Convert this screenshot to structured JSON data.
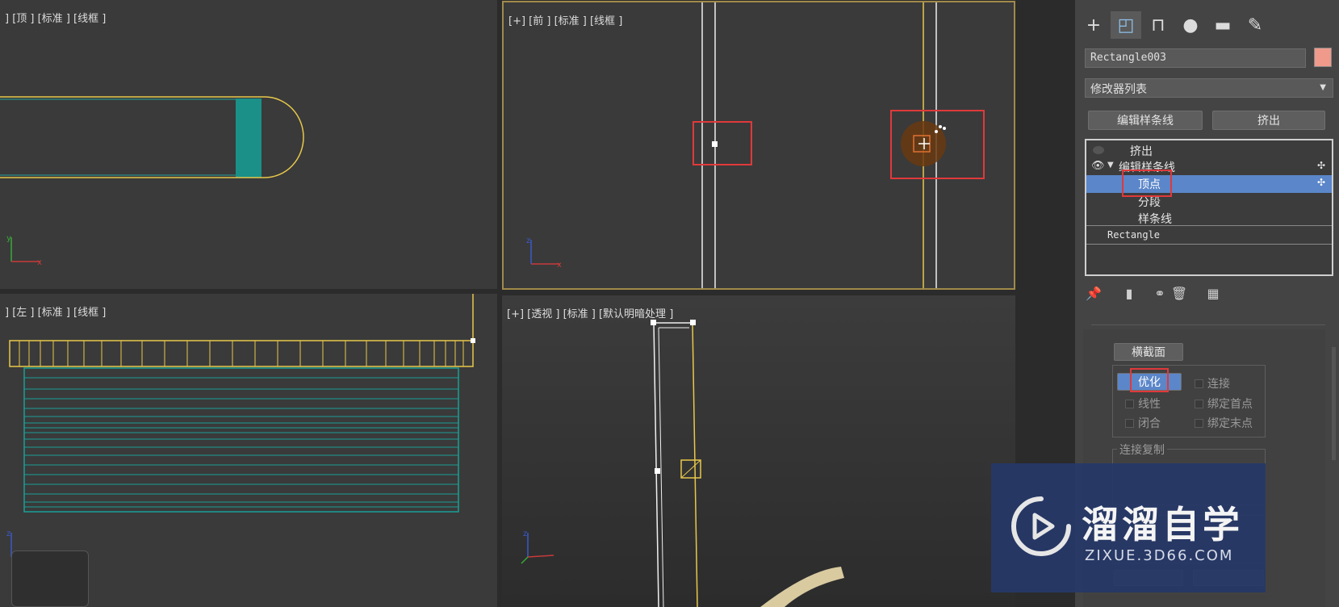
{
  "viewports": {
    "top_label": "] [顶 ] [标准 ] [线框 ]",
    "front_label": "[+] [前 ] [标准 ] [线框 ]",
    "left_label": "] [左 ] [标准 ] [线框 ]",
    "persp_label": "[+] [透视 ] [标准 ] [默认明暗处理 ]"
  },
  "panel": {
    "tabs": [
      {
        "icon": "plus-icon",
        "glyph": "+"
      },
      {
        "icon": "modify-icon",
        "glyph": "◰"
      },
      {
        "icon": "hierarchy-icon",
        "glyph": "⊓"
      },
      {
        "icon": "motion-icon",
        "glyph": "●"
      },
      {
        "icon": "display-icon",
        "glyph": "▬"
      },
      {
        "icon": "utilities-icon",
        "glyph": "✎"
      }
    ],
    "object_name": "Rectangle003",
    "object_color": "#f09a8c",
    "modifier_list": "修改器列表",
    "buttons": {
      "edit_spline": "编辑样条线",
      "extrude": "挤出"
    },
    "stack": {
      "extrude": "挤出",
      "edit_spline": "编辑样条线",
      "vertex": "顶点",
      "segment": "分段",
      "spline": "样条线",
      "rectangle": "Rectangle"
    },
    "rollout": {
      "cross_section": "横截面",
      "optimize": "优化",
      "connect": "连接",
      "linear": "线性",
      "bind_first": "绑定首点",
      "closed": "闭合",
      "bind_last": "绑定末点",
      "connect_copy": "连接复制"
    }
  },
  "watermark": {
    "title": "溜溜自学",
    "subtitle": "ZIXUE.3D66.COM"
  },
  "colors": {
    "selection": "#5b86c9",
    "highlight": "#e0393b",
    "spline": "#e8c84a",
    "teal": "#1a9e96"
  }
}
